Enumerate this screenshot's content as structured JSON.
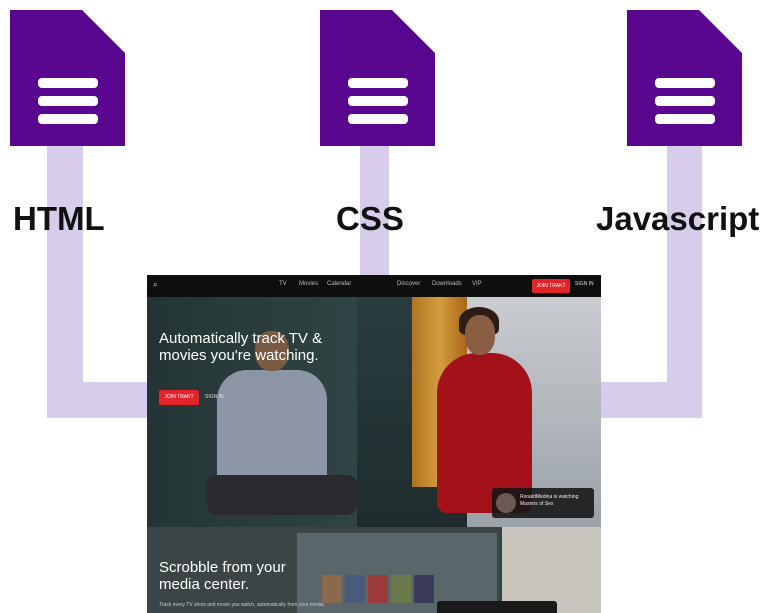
{
  "colors": {
    "doc_icon": "#5a078f",
    "arrow": "#d7cdea",
    "label_text": "#111111",
    "accent_red": "#e3252b"
  },
  "labels": {
    "html": "HTML",
    "css": "CSS",
    "javascript": "Javascript"
  },
  "icons": [
    "document-icon",
    "document-icon",
    "document-icon"
  ],
  "screenshot": {
    "nav": {
      "search_icon": "⌕",
      "items": [
        "TV",
        "Movies",
        "Calendar",
        "Discover",
        "Downloads",
        "VIP"
      ],
      "join_button": "JOIN TRAKT",
      "sign_in": "SIGN IN"
    },
    "hero": {
      "headline": "Automatically track TV & movies you're watching.",
      "cta_button": "JOIN TRAKT",
      "cta_signin": "SIGN IN"
    },
    "toast": {
      "text": "RonaldMedina is watching Masters of Sex"
    },
    "section2": {
      "headline": "Scrobble from your media center.",
      "subtext": "Track every TV show and movie you watch, automatically from your media"
    }
  }
}
